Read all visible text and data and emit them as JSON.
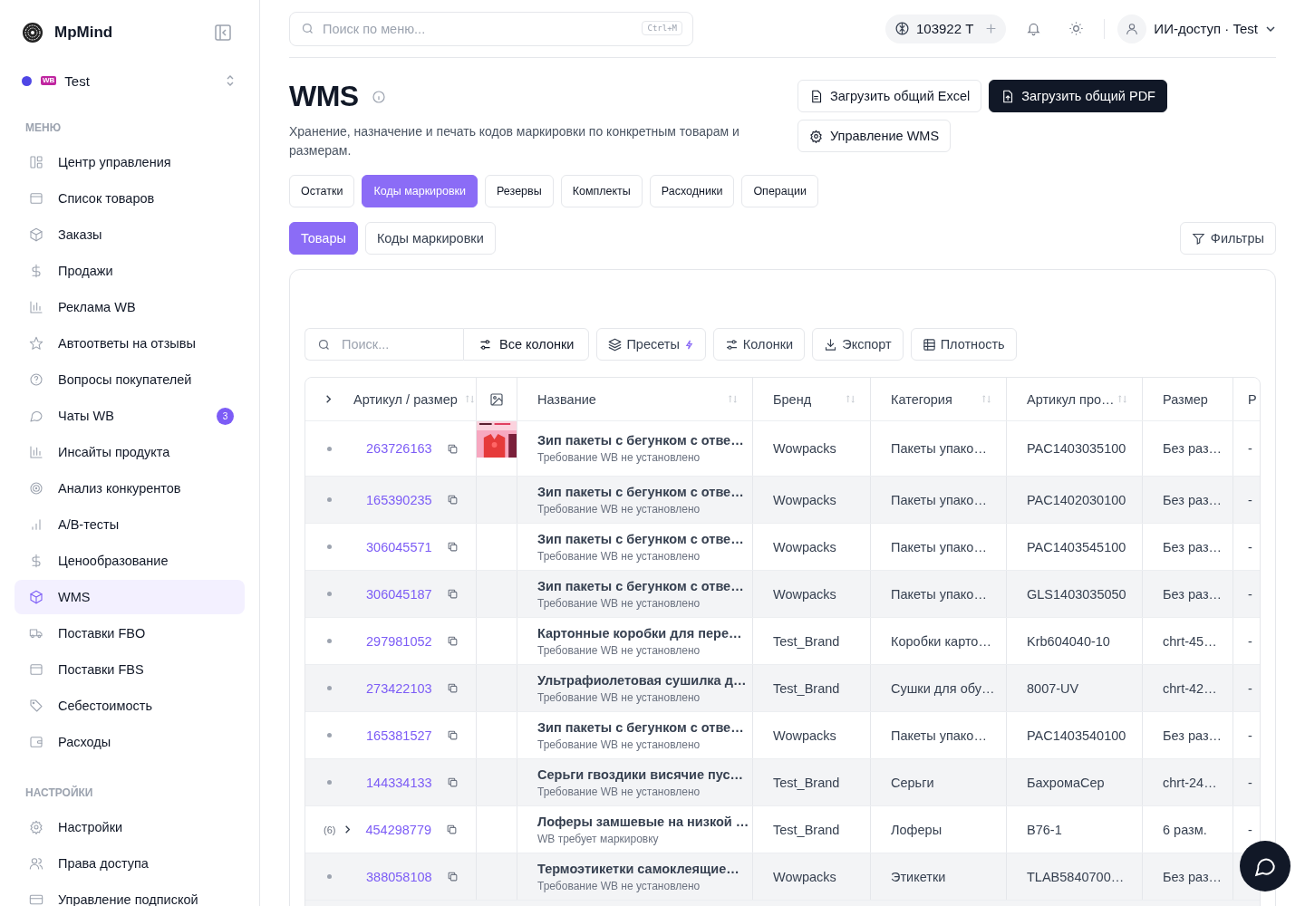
{
  "brand": {
    "name": "MpMind"
  },
  "workspace": {
    "name": "Test",
    "badge": "WB",
    "color": "#4f46e5"
  },
  "sidebar": {
    "sections": [
      {
        "title": "МЕНЮ",
        "items": [
          {
            "label": "Центр управления",
            "selected": false
          },
          {
            "label": "Список товаров",
            "selected": false
          },
          {
            "label": "Заказы",
            "selected": false
          },
          {
            "label": "Продажи",
            "selected": false
          },
          {
            "label": "Реклама WB",
            "selected": false
          },
          {
            "label": "Автоответы на отзывы",
            "selected": false
          },
          {
            "label": "Вопросы покупателей",
            "selected": false
          },
          {
            "label": "Чаты WB",
            "selected": false,
            "badge": "3"
          },
          {
            "label": "Инсайты продукта",
            "selected": false
          },
          {
            "label": "Анализ конкурентов",
            "selected": false
          },
          {
            "label": "A/B-тесты",
            "selected": false
          },
          {
            "label": "Ценообразование",
            "selected": false
          },
          {
            "label": "WMS",
            "selected": true
          },
          {
            "label": "Поставки FBO",
            "selected": false
          },
          {
            "label": "Поставки FBS",
            "selected": false
          },
          {
            "label": "Себестоимость",
            "selected": false
          },
          {
            "label": "Расходы",
            "selected": false
          }
        ]
      },
      {
        "title": "НАСТРОЙКИ",
        "items": [
          {
            "label": "Настройки",
            "selected": false
          },
          {
            "label": "Права доступа",
            "selected": false
          },
          {
            "label": "Управление подпиской",
            "selected": false
          }
        ]
      }
    ]
  },
  "topbar": {
    "search_placeholder": "Поиск по меню...",
    "shortcut": "Ctrl+M",
    "tokens": "103922 Т",
    "user": "ИИ-доступ · Test"
  },
  "page": {
    "title": "WMS",
    "description": "Хранение, назначение и печать кодов маркировки по конкретным товарам и размерам.",
    "actions": [
      {
        "label": "Загрузить общий Excel",
        "kind": "outline"
      },
      {
        "label": "Загрузить общий PDF",
        "kind": "dark"
      },
      {
        "label": "Управление WMS",
        "kind": "outline"
      }
    ]
  },
  "tabs": [
    {
      "label": "Остатки",
      "selected": false
    },
    {
      "label": "Коды маркировки",
      "selected": true
    },
    {
      "label": "Резервы",
      "selected": false
    },
    {
      "label": "Комплекты",
      "selected": false
    },
    {
      "label": "Расходники",
      "selected": false
    },
    {
      "label": "Операции",
      "selected": false
    }
  ],
  "subtabs": [
    {
      "label": "Товары",
      "selected": true
    },
    {
      "label": "Коды маркировки",
      "selected": false
    }
  ],
  "filters_button": "Фильтры",
  "toolbar": {
    "search_placeholder": "Поиск...",
    "all_columns": "Все колонки",
    "buttons": [
      "Пресеты",
      "Колонки",
      "Экспорт",
      "Плотность"
    ]
  },
  "table": {
    "columns": [
      "Артикул / размер",
      "",
      "Название",
      "Бренд",
      "Категория",
      "Артикул про…",
      "Размер",
      "Р"
    ],
    "rows": [
      {
        "article": "263726163",
        "image": true,
        "name": "Зип пакеты с бегунком с отве…",
        "note": "Требование WB не установлено",
        "brand": "Wowpacks",
        "category": "Пакеты упако…",
        "vendor_code": "PAC1403035100",
        "size": "Без раз…",
        "column_8": "-"
      },
      {
        "article": "165390235",
        "image": false,
        "name": "Зип пакеты с бегунком с отве…",
        "note": "Требование WB не установлено",
        "brand": "Wowpacks",
        "category": "Пакеты упако…",
        "vendor_code": "PAC1402030100",
        "size": "Без раз…",
        "column_8": "-"
      },
      {
        "article": "306045571",
        "image": false,
        "name": "Зип пакеты с бегунком с отве…",
        "note": "Требование WB не установлено",
        "brand": "Wowpacks",
        "category": "Пакеты упако…",
        "vendor_code": "PAC1403545100",
        "size": "Без раз…",
        "column_8": "-"
      },
      {
        "article": "306045187",
        "image": false,
        "name": "Зип пакеты с бегунком с отве…",
        "note": "Требование WB не установлено",
        "brand": "Wowpacks",
        "category": "Пакеты упако…",
        "vendor_code": "GLS1403035050",
        "size": "Без раз…",
        "column_8": "-"
      },
      {
        "article": "297981052",
        "image": false,
        "name": "Картонные коробки для пере…",
        "note": "Требование WB не установлено",
        "brand": "Test_Brand",
        "category": "Коробки карто…",
        "vendor_code": "Krb604040-10",
        "size": "chrt-45…",
        "column_8": "-"
      },
      {
        "article": "273422103",
        "image": false,
        "name": "Ультрафиолетовая сушилка д…",
        "note": "Требование WB не установлено",
        "brand": "Test_Brand",
        "category": "Сушки для обу…",
        "vendor_code": "8007-UV",
        "size": "chrt-42…",
        "column_8": "-"
      },
      {
        "article": "165381527",
        "image": false,
        "name": "Зип пакеты с бегунком с отве…",
        "note": "Требование WB не установлено",
        "brand": "Wowpacks",
        "category": "Пакеты упако…",
        "vendor_code": "PAC1403540100",
        "size": "Без раз…",
        "column_8": "-"
      },
      {
        "article": "144334133",
        "image": false,
        "name": "Серьги гвоздики висячие пус…",
        "note": "Требование WB не установлено",
        "brand": "Test_Brand",
        "category": "Серьги",
        "vendor_code": "БахромаСер",
        "size": "chrt-24…",
        "column_8": "-"
      },
      {
        "article": "454298779",
        "image": false,
        "variants": "(6)",
        "name": "Лоферы замшевые на низкой …",
        "note": "WB требует маркировку",
        "brand": "Test_Brand",
        "category": "Лоферы",
        "vendor_code": "B76-1",
        "size": "6 разм.",
        "column_8": "-"
      },
      {
        "article": "388058108",
        "image": false,
        "name": "Термоэтикетки самоклеящие…",
        "note": "Требование WB не установлено",
        "brand": "Wowpacks",
        "category": "Этикетки",
        "vendor_code": "TLAB5840700…",
        "size": "Без раз…"
      }
    ]
  }
}
